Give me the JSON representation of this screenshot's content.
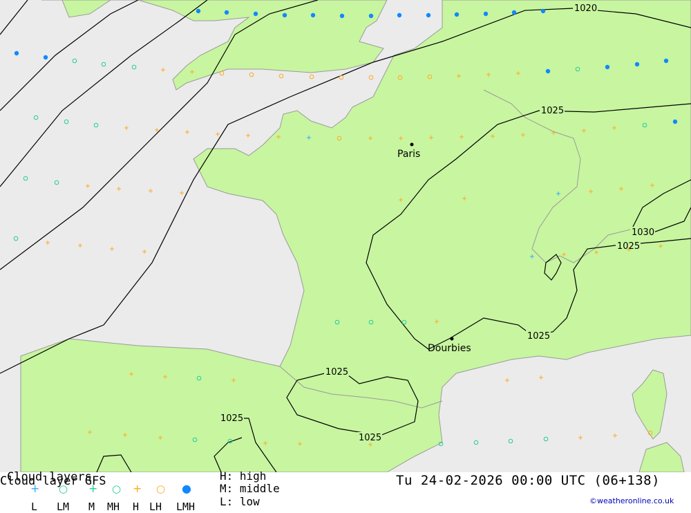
{
  "legend": {
    "title": "Cloud layers",
    "model": "Cloud layer   GFS",
    "keys": [
      "L",
      "LM",
      "M",
      "MH",
      "H",
      "LH",
      "LMH"
    ],
    "high": "H: high",
    "middle": "M: middle",
    "low": "L: low"
  },
  "datetime": "Tu 24-02-2026 00:00 UTC (06+138)",
  "credit": "©weatheronline.co.uk",
  "places": {
    "paris": "Paris",
    "dourbies": "Dourbies"
  },
  "isobars": [
    "1020",
    "1025",
    "1025",
    "1030",
    "1025",
    "1025",
    "1025",
    "1025",
    "1025"
  ],
  "colors": {
    "land": "#c8f5a0",
    "sea": "#ebebeb",
    "low": "#33aaff",
    "middle": "#22cc99",
    "high": "#ffaa22",
    "lmh": "#1188ff"
  }
}
